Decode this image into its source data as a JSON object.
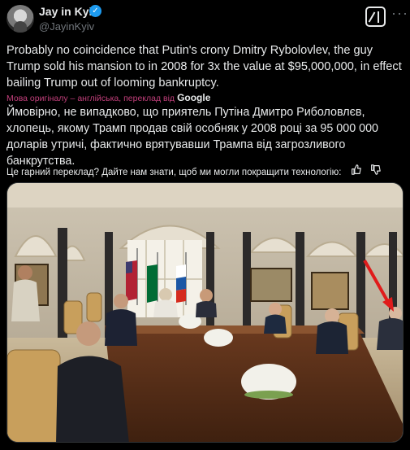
{
  "author": {
    "name": "Jay in Kyiv",
    "handle": "@JayinKyiv",
    "verified_icon": "verified-badge-icon",
    "accent": "#1d9bf0"
  },
  "header_icons": {
    "grok": "grok-icon",
    "more": "more-options-icon"
  },
  "tweet": {
    "text_original": "Probably no coincidence that Putin's crony Dmitry Rybolovlev, the guy Trump sold his mansion to in 2008 for 3x the value at $95,000,000, in effect bailing Trump out of looming bankruptcy.",
    "translation_note": "Мова оригіналу – англійська, переклад від",
    "translation_provider": "Google",
    "text_translated": "Ймовірно, не випадково, що приятель Путіна Дмитро Риболовлєв, хлопець, якому Трамп продав свій особняк у 2008 році за 95 000 000 доларів утричі, фактично врятувавши Трампа від загрозливого банкрутства.",
    "feedback_prompt": "Це гарний переклад? Дайте нам знати, щоб ми могли покращити технологію:"
  },
  "feedback_icons": [
    "thumbs-up-icon",
    "thumbs-down-icon"
  ],
  "media": {
    "kind": "photo",
    "description_icon": "meeting-photo",
    "annotation_color": "#e01b1b"
  }
}
